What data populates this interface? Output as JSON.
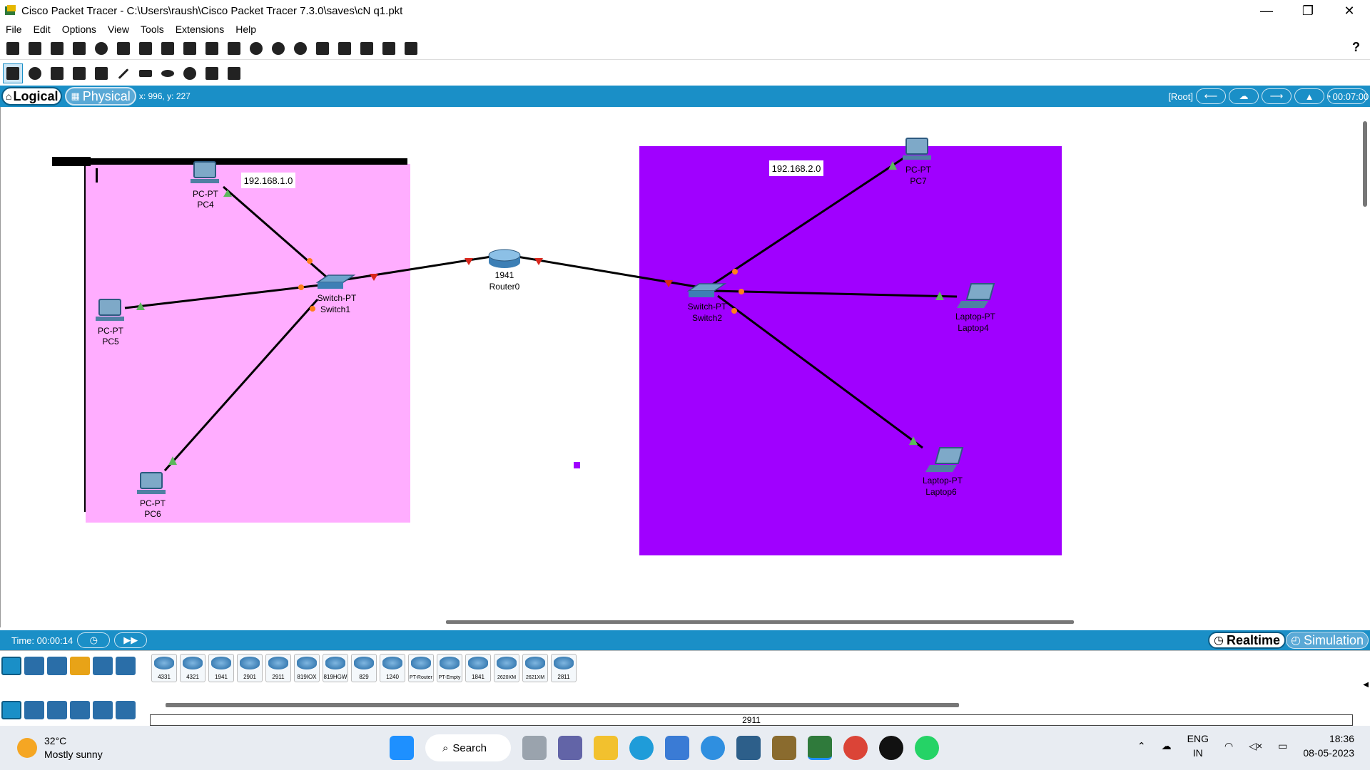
{
  "window": {
    "title": "Cisco Packet Tracer - C:\\Users\\raush\\Cisco Packet Tracer 7.3.0\\saves\\cN q1.pkt",
    "minimize": "—",
    "restore": "❐",
    "close": "✕"
  },
  "menu": [
    "File",
    "Edit",
    "Options",
    "View",
    "Tools",
    "Extensions",
    "Help"
  ],
  "toolbar": {
    "help": "?"
  },
  "mode": {
    "logical": "Logical",
    "physical": "Physical",
    "coords": "x: 996, y: 227",
    "root": "[Root]",
    "clock": "00:07:00"
  },
  "topology": {
    "clusters": [
      {
        "label": "192.168.1.0",
        "color": "#ffadff"
      },
      {
        "label": "192.168.2.0",
        "color": "#a000ff"
      }
    ],
    "devices": {
      "pc4": {
        "type": "PC-PT",
        "name": "PC4"
      },
      "pc5": {
        "type": "PC-PT",
        "name": "PC5"
      },
      "pc6": {
        "type": "PC-PT",
        "name": "PC6"
      },
      "switch1": {
        "type": "Switch-PT",
        "name": "Switch1"
      },
      "router0": {
        "type": "1941",
        "name": "Router0"
      },
      "switch2": {
        "type": "Switch-PT",
        "name": "Switch2"
      },
      "pc7": {
        "type": "PC-PT",
        "name": "PC7"
      },
      "laptop4": {
        "type": "Laptop-PT",
        "name": "Laptop4"
      },
      "laptop6": {
        "type": "Laptop-PT",
        "name": "Laptop6"
      }
    },
    "status_colors": {
      "up": "#5cb85c",
      "down": "#d9261c",
      "pending": "#ff7f1a"
    }
  },
  "timebar": {
    "time": "Time: 00:00:14",
    "realtime": "Realtime",
    "simulation": "Simulation"
  },
  "device_models": [
    "4331",
    "4321",
    "1941",
    "2901",
    "2911",
    "819IOX",
    "819HGW",
    "829",
    "1240",
    "PT-Router",
    "PT-Empty",
    "1841",
    "2620XM",
    "2621XM",
    "2811"
  ],
  "selected_model": "2911",
  "taskbar": {
    "temperature": "32°C",
    "weather": "Mostly sunny",
    "search": "Search",
    "lang1": "ENG",
    "lang2": "IN",
    "time": "18:36",
    "date": "08-05-2023"
  }
}
